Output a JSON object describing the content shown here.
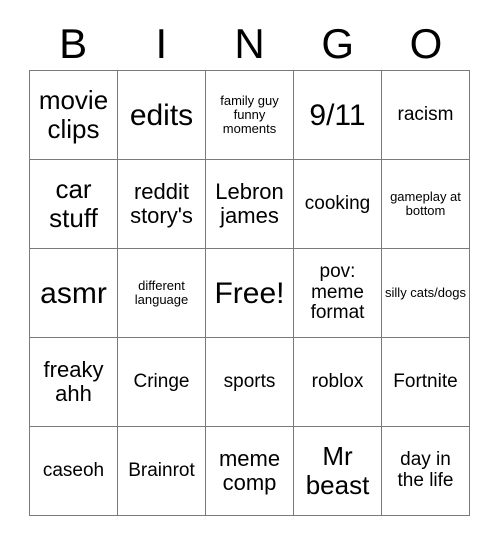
{
  "card": {
    "header_letters": [
      "B",
      "I",
      "N",
      "G",
      "O"
    ],
    "columns": 5,
    "rows": 5,
    "border_color": "#7a7a7a",
    "text_color": "#000000",
    "background_color": "#ffffff",
    "cells": [
      [
        {
          "text": "movie clips",
          "size": "lg"
        },
        {
          "text": "edits",
          "size": "xl"
        },
        {
          "text": "family guy funny moments",
          "size": "xs"
        },
        {
          "text": "9/11",
          "size": "xl"
        },
        {
          "text": "racism",
          "size": "sm"
        }
      ],
      [
        {
          "text": "car stuff",
          "size": "lg"
        },
        {
          "text": "reddit story's",
          "size": "md"
        },
        {
          "text": "Lebron james",
          "size": "md"
        },
        {
          "text": "cooking",
          "size": "sm"
        },
        {
          "text": "gameplay at bottom",
          "size": "xs"
        }
      ],
      [
        {
          "text": "asmr",
          "size": "xl"
        },
        {
          "text": "different language",
          "size": "xs"
        },
        {
          "text": "Free!",
          "size": "xl"
        },
        {
          "text": "pov: meme format",
          "size": "sm"
        },
        {
          "text": "silly cats/dogs",
          "size": "xs"
        }
      ],
      [
        {
          "text": "freaky ahh",
          "size": "md"
        },
        {
          "text": "Cringe",
          "size": "sm"
        },
        {
          "text": "sports",
          "size": "sm"
        },
        {
          "text": "roblox",
          "size": "sm"
        },
        {
          "text": "Fortnite",
          "size": "sm"
        }
      ],
      [
        {
          "text": "caseoh",
          "size": "sm"
        },
        {
          "text": "Brainrot",
          "size": "sm"
        },
        {
          "text": "meme comp",
          "size": "md"
        },
        {
          "text": "Mr beast",
          "size": "lg"
        },
        {
          "text": "day in the life",
          "size": "sm"
        }
      ]
    ],
    "free_space": {
      "row": 2,
      "col": 2,
      "label": "Free!"
    }
  }
}
